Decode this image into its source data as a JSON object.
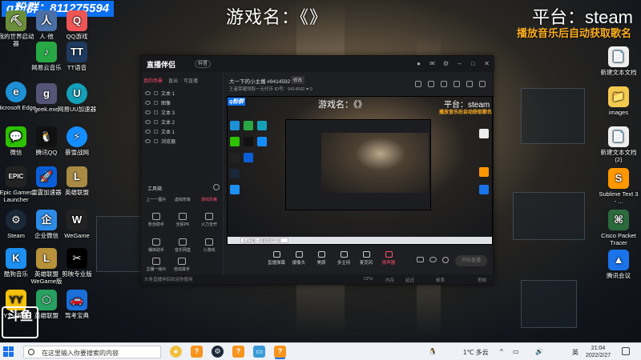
{
  "overlay": {
    "qq_group": "q粉群：811275594",
    "game_name": "游戏名：《》",
    "platform": "平台：steam",
    "song_request": "播放音乐后自动获取歌名"
  },
  "desktop_icons": {
    "left_col1": [
      "我的世界启动器",
      "Microsoft Edge",
      "微信",
      "Epic Games Launcher",
      "Steam",
      "酷狗音乐",
      "YY - 探索"
    ],
    "left_col2": [
      "人·他",
      "网易云音乐",
      "geek.exe",
      "腾讯QQ",
      "雷霆加速器",
      "企业微信",
      "英雄联盟WeGame版",
      "英雄联盟"
    ],
    "left_col3": [
      "QQ游戏",
      "TT语音",
      "网易UU加速器",
      "暴雪战网",
      "英雄联盟",
      "WeGame",
      "剪映专业版",
      "驾考宝典"
    ],
    "right_col": [
      "新建文本文档",
      "images",
      "新建文本文档(2)",
      "Sublime Text 3 - ...",
      "Cisco Packet Tracer",
      "腾讯会议"
    ]
  },
  "app": {
    "logo": "直播伴侣",
    "version": "抖音",
    "left_tabs": [
      "我的场景",
      "直出",
      "可直播"
    ],
    "scenes": [
      "文本 1",
      "图像",
      "文本 3",
      "文本 2",
      "文本 1",
      "浏览器"
    ],
    "toolbox_title": "工具箱",
    "tool_rows": [
      [
        "上一一图片",
        "虚拟形象",
        "游戏风格"
      ],
      [
        "粉丝助手",
        "全民PK",
        "火力全开"
      ],
      [
        "播库助手",
        "音乐网盒",
        "小游戏"
      ],
      [
        "主播一级片",
        "自动其手"
      ]
    ],
    "room_title": "大一下的小主播 #9414592",
    "room_edit": "修改",
    "room_sub": "王者荣耀领取一元代币 ID号：9414592  ♥ 0",
    "status_bar": "头条直播伴侣欢迎你使用",
    "status_items": [
      "CPU",
      "内存",
      "延迟",
      "帧率",
      "丢帧"
    ],
    "bottom_tools": [
      "直播弹幕",
      "摄像头",
      "美颜",
      "多主持",
      "麦克风",
      "扬声器"
    ],
    "start_button": "开始直播"
  },
  "preview": {
    "qq": "q粉群",
    "game": "游戏名：《》",
    "platform": "平台：steam",
    "song": "播放音乐后自动获取歌名",
    "search": "在这里输入你要搜索的内容"
  },
  "taskbar": {
    "search_placeholder": "在这里输入你要搜索的内容",
    "weather": "1℃  多云",
    "ime": "英",
    "time": "21:04",
    "date": "2022/2/27"
  }
}
